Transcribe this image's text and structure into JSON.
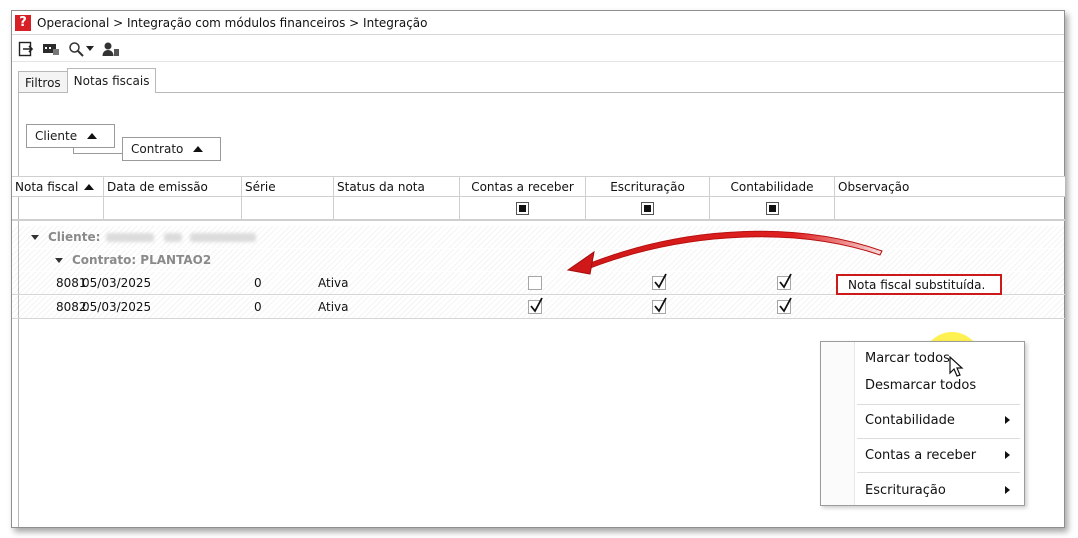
{
  "window": {
    "app_logo_text": "?",
    "breadcrumb": "Operacional > Integração com módulos financeiros > Integração"
  },
  "toolbar": {
    "items": [
      {
        "icon": "export-icon"
      },
      {
        "icon": "screen-chat-icon"
      },
      {
        "icon": "search-icon",
        "has_dropdown": true
      },
      {
        "icon": "user-icon"
      }
    ]
  },
  "tabs": [
    {
      "label": "Filtros",
      "active": false
    },
    {
      "label": "Notas fiscais",
      "active": true
    }
  ],
  "group_panel": {
    "first": "Cliente",
    "second": "Contrato"
  },
  "grid": {
    "columns": [
      {
        "label": "Nota fiscal",
        "sort": "asc"
      },
      {
        "label": "Data de emissão"
      },
      {
        "label": "Série"
      },
      {
        "label": "Status da nota"
      },
      {
        "label": "Contas a receber"
      },
      {
        "label": "Escrituração"
      },
      {
        "label": "Contabilidade"
      },
      {
        "label": "Observação"
      }
    ],
    "group_client_label": "Cliente:",
    "group_contract_label": "Contrato: PLANTAO2",
    "rows": [
      {
        "nota": "8081",
        "data": "05/03/2025",
        "serie": "0",
        "status": "Ativa",
        "contas_receber": false,
        "escrituracao": true,
        "contabilidade": true,
        "observacao": "Nota fiscal substituída."
      },
      {
        "nota": "8082",
        "data": "05/03/2025",
        "serie": "0",
        "status": "Ativa",
        "contas_receber": true,
        "escrituracao": true,
        "contabilidade": true,
        "observacao": ""
      }
    ]
  },
  "context_menu": {
    "items": [
      "Marcar todos",
      "Desmarcar todos"
    ],
    "submenus": [
      "Contabilidade",
      "Contas a receber",
      "Escrituração"
    ]
  },
  "colors": {
    "accent_red": "#cc1a1a",
    "logo_red": "#d71f26",
    "cursor_highlight": "#ffee33"
  }
}
